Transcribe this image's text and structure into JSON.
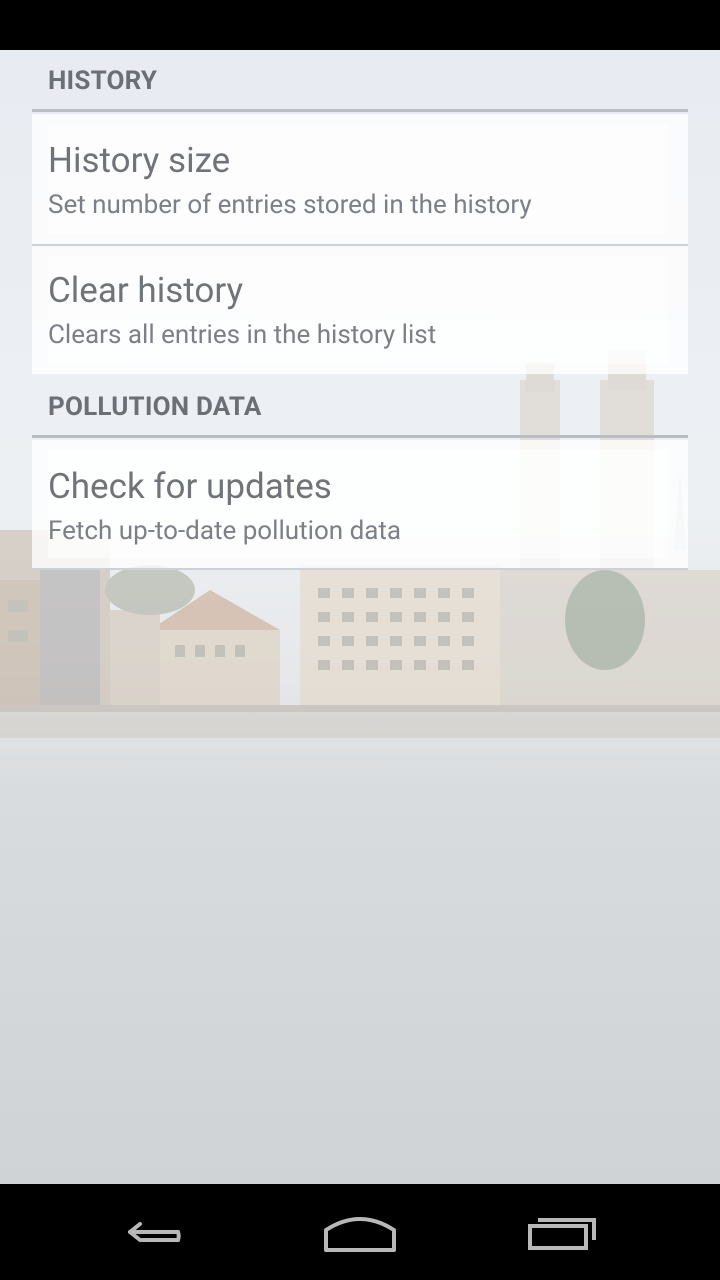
{
  "sections": [
    {
      "header": "HISTORY",
      "items": [
        {
          "title": "History size",
          "summary": "Set number of entries stored in the history"
        },
        {
          "title": "Clear history",
          "summary": "Clears all entries in the history list"
        }
      ]
    },
    {
      "header": "POLLUTION DATA",
      "items": [
        {
          "title": "Check for updates",
          "summary": "Fetch up-to-date pollution data"
        }
      ]
    }
  ],
  "navigation": {
    "icons": [
      "back-icon",
      "home-icon",
      "recent-apps-icon"
    ]
  },
  "colors": {
    "status_bar": "#000000",
    "nav_bar": "#000000",
    "section_header_text": "#6b6f76",
    "pref_title_text": "#707478",
    "pref_summary_text": "#7c8084"
  }
}
